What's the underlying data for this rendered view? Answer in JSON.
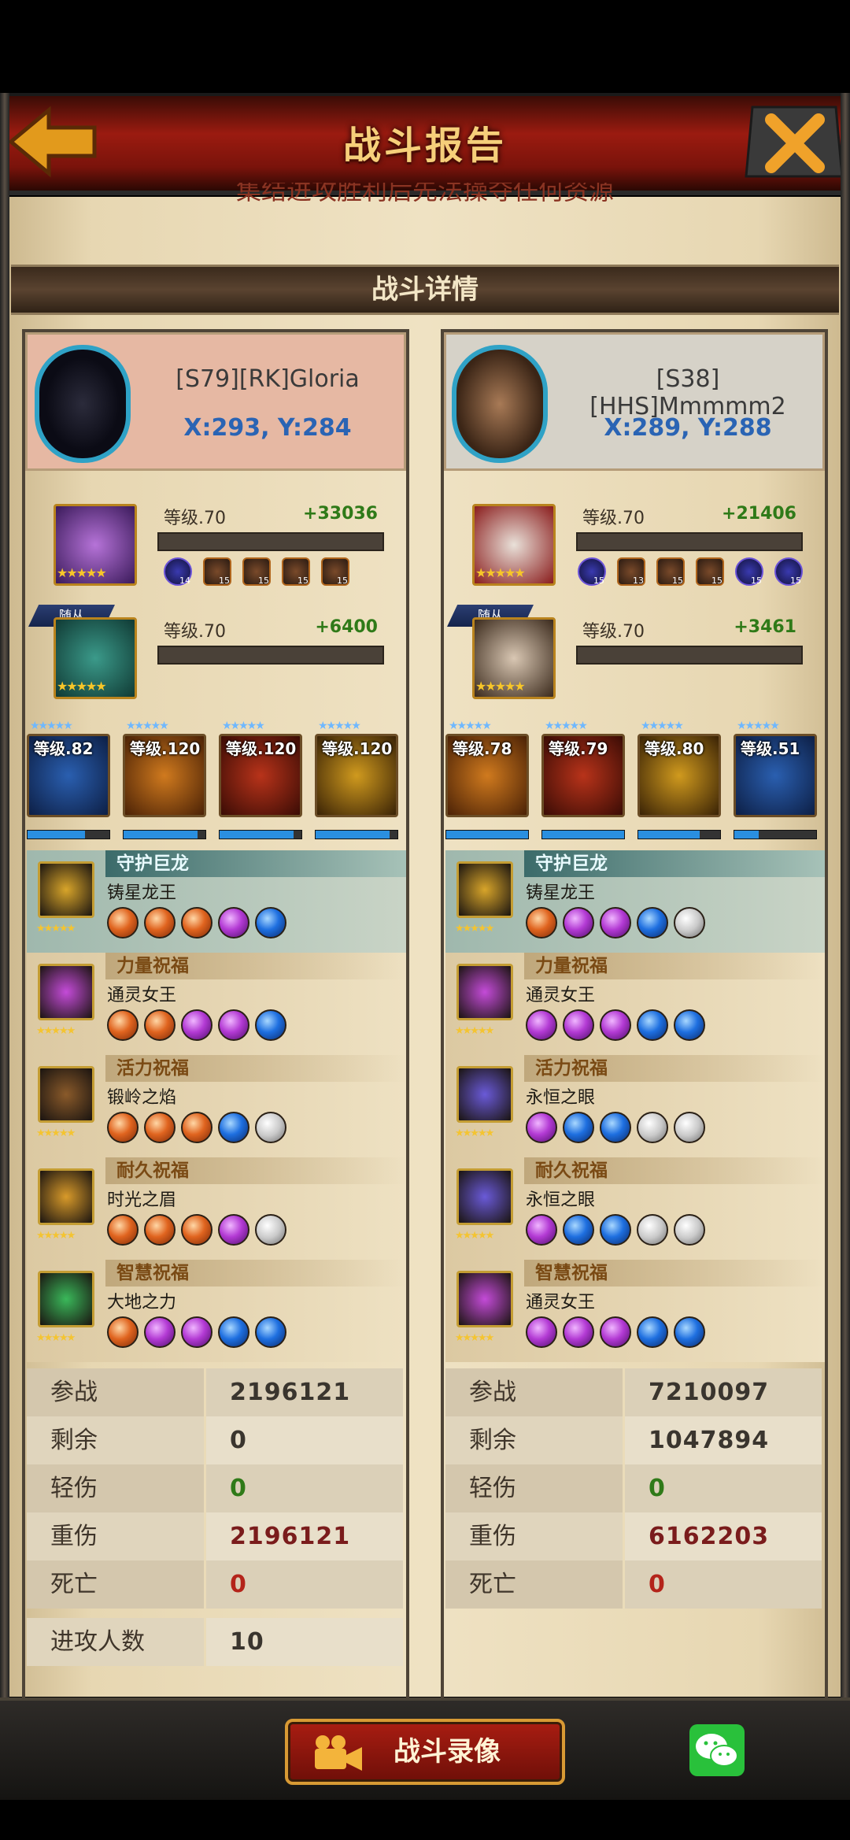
{
  "header": {
    "title": "战斗报告"
  },
  "clipped_text": "集结进攻胜利后先法操夺任何资源",
  "section_title": "战斗详情",
  "attacker": {
    "name": "[S79][RK]Gloria",
    "coord": "X:293, Y:284",
    "hero": {
      "level": "等级.70",
      "power": "+33036",
      "equips": [
        "14",
        "15",
        "15",
        "15",
        "15"
      ]
    },
    "follower": {
      "tag": "随从",
      "level": "等级.70",
      "power": "+6400"
    },
    "troops": [
      {
        "label": "等级.82",
        "fill": 0.7
      },
      {
        "label": "等级.120",
        "fill": 0.9
      },
      {
        "label": "等级.120",
        "fill": 0.9
      },
      {
        "label": "等级.120",
        "fill": 0.9
      }
    ],
    "dragons": [
      {
        "header": "守护巨龙",
        "name": "铸星龙王",
        "gems": [
          "o",
          "o",
          "o",
          "p",
          "b"
        ]
      },
      {
        "header": "力量祝福",
        "name": "通灵女王",
        "gems": [
          "o",
          "o",
          "p",
          "p",
          "b"
        ]
      },
      {
        "header": "活力祝福",
        "name": "锻岭之焰",
        "gems": [
          "o",
          "o",
          "o",
          "b",
          "w"
        ]
      },
      {
        "header": "耐久祝福",
        "name": "时光之眉",
        "gems": [
          "o",
          "o",
          "o",
          "p",
          "w"
        ]
      },
      {
        "header": "智慧祝福",
        "name": "大地之力",
        "gems": [
          "o",
          "p",
          "p",
          "b",
          "b"
        ]
      }
    ],
    "stats": [
      {
        "label": "参战",
        "value": "2196121",
        "color": "#3a352e"
      },
      {
        "label": "剩余",
        "value": "0",
        "color": "#3a352e"
      },
      {
        "label": "轻伤",
        "value": "0",
        "color": "#2f7a18"
      },
      {
        "label": "重伤",
        "value": "2196121",
        "color": "#7a1c1c"
      },
      {
        "label": "死亡",
        "value": "0",
        "color": "#b4241a"
      },
      {
        "label": "进攻人数",
        "value": "10",
        "color": "#3a352e"
      }
    ]
  },
  "defender": {
    "name": "[S38][HHS]Mmmmm2",
    "coord": "X:289, Y:288",
    "hero": {
      "level": "等级.70",
      "power": "+21406",
      "equips": [
        "15",
        "13",
        "15",
        "15",
        "15",
        "15"
      ]
    },
    "follower": {
      "tag": "随从",
      "level": "等级.70",
      "power": "+3461"
    },
    "troops": [
      {
        "label": "等级.78",
        "fill": 1.0
      },
      {
        "label": "等级.79",
        "fill": 1.0
      },
      {
        "label": "等级.80",
        "fill": 0.75
      },
      {
        "label": "等级.51",
        "fill": 0.3
      }
    ],
    "dragons": [
      {
        "header": "守护巨龙",
        "name": "铸星龙王",
        "gems": [
          "o",
          "p",
          "p",
          "b",
          "w"
        ]
      },
      {
        "header": "力量祝福",
        "name": "通灵女王",
        "gems": [
          "p",
          "p",
          "p",
          "b",
          "b"
        ]
      },
      {
        "header": "活力祝福",
        "name": "永恒之眼",
        "gems": [
          "p",
          "b",
          "b",
          "w",
          "w"
        ]
      },
      {
        "header": "耐久祝福",
        "name": "永恒之眼",
        "gems": [
          "p",
          "b",
          "b",
          "w",
          "w"
        ]
      },
      {
        "header": "智慧祝福",
        "name": "通灵女王",
        "gems": [
          "p",
          "p",
          "p",
          "b",
          "b"
        ]
      }
    ],
    "stats": [
      {
        "label": "参战",
        "value": "7210097",
        "color": "#3a352e"
      },
      {
        "label": "剩余",
        "value": "1047894",
        "color": "#3a352e"
      },
      {
        "label": "轻伤",
        "value": "0",
        "color": "#2f7a18"
      },
      {
        "label": "重伤",
        "value": "6162203",
        "color": "#7a1c1c"
      },
      {
        "label": "死亡",
        "value": "0",
        "color": "#b4241a"
      }
    ]
  },
  "footer": {
    "replay_label": "战斗录像"
  }
}
